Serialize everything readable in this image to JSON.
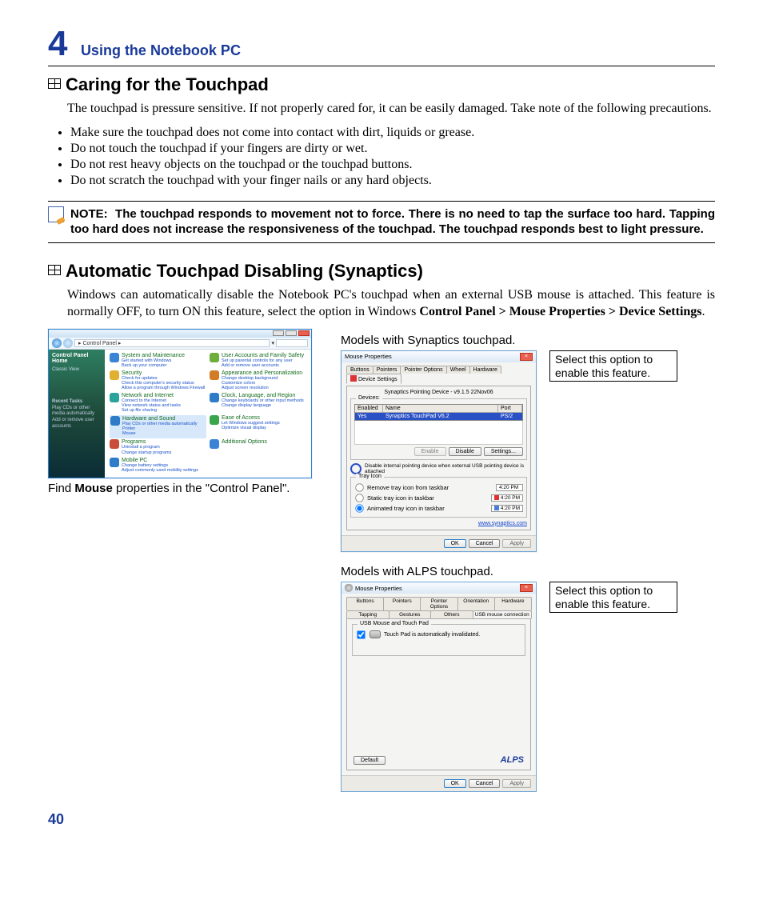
{
  "chapter": {
    "num": "4",
    "title": "Using the Notebook PC"
  },
  "section1": {
    "heading": "Caring for the Touchpad",
    "intro": "The touchpad is pressure sensitive. If not properly cared for, it can be easily damaged. Take note of the following precautions.",
    "bullets": [
      "Make sure the touchpad does not come into contact with dirt, liquids or grease.",
      "Do not touch the touchpad if your fingers are dirty or wet.",
      "Do not rest heavy objects on the touchpad or the touchpad buttons.",
      "Do not scratch the touchpad with your finger nails or any hard objects."
    ],
    "note_label": "NOTE:",
    "note": "The touchpad responds to movement not to force. There is no need to tap the surface too hard. Tapping too hard does not increase the responsiveness of the touchpad. The touchpad responds best to light pressure."
  },
  "section2": {
    "heading": "Automatic Touchpad Disabling (Synaptics)",
    "intro1": "Windows can automatically disable the Notebook PC's touchpad when an external USB mouse is attached. This feature is normally OFF, to turn ON this feature, select the option in Windows ",
    "navpath": "Control Panel > Mouse Properties > Device Settings",
    "cp_caption_prefix": "Find ",
    "cp_caption_bold": "Mouse",
    "cp_caption_suffix": " properties in the \"Control Panel\".",
    "syn_hdr": "Models with Synaptics touchpad.",
    "alps_hdr": "Models with ALPS touchpad.",
    "callout": "Select this option to enable this feature."
  },
  "control_panel": {
    "path": "▸ Control Panel ▸",
    "home": "Control Panel Home",
    "view": "Classic View",
    "tasks_label": "Recent Tasks",
    "tasks": "Play CDs or other media automatically\nAdd or remove user accounts",
    "items": [
      {
        "title": "System and Maintenance",
        "sub": "Get started with Windows\nBack up your computer",
        "color": "#3a84d6"
      },
      {
        "title": "User Accounts and Family Safety",
        "sub": "Set up parental controls for any user\nAdd or remove user accounts",
        "color": "#6eae3b"
      },
      {
        "title": "Security",
        "sub": "Check for updates\nCheck this computer's security status\nAllow a program through Windows Firewall",
        "color": "#e0b030"
      },
      {
        "title": "Appearance and Personalization",
        "sub": "Change desktop background\nCustomize colors\nAdjust screen resolution",
        "color": "#d37c28"
      },
      {
        "title": "Network and Internet",
        "sub": "Connect to the Internet\nView network status and tasks\nSet up file sharing",
        "color": "#2aa39a"
      },
      {
        "title": "Clock, Language, and Region",
        "sub": "Change keyboards or other input methods\nChange display language",
        "color": "#2e7cc7"
      },
      {
        "title": "Hardware and Sound",
        "sub": "Play CDs or other media automatically\nPrinter\nMouse",
        "color": "#2e7cc7",
        "highlight": true
      },
      {
        "title": "Ease of Access",
        "sub": "Let Windows suggest settings\nOptimize visual display",
        "color": "#3aa64b"
      },
      {
        "title": "Programs",
        "sub": "Uninstall a program\nChange startup programs",
        "color": "#c94d38"
      },
      {
        "title": "Additional Options",
        "sub": "",
        "color": "#3a84d6"
      },
      {
        "title": "Mobile PC",
        "sub": "Change battery settings\nAdjust commonly used mobility settings",
        "color": "#2e7cc7"
      }
    ]
  },
  "synaptics": {
    "title": "Mouse Properties",
    "tabs": [
      "Buttons",
      "Pointers",
      "Pointer Options",
      "Wheel",
      "Hardware"
    ],
    "active_tab": "Device Settings",
    "subtitle": "Synaptics Pointing Device - v9.1.5  22Nov06",
    "devices_label": "Devices:",
    "cols": {
      "c1": "Enabled",
      "c2": "Name",
      "c3": "Port"
    },
    "row": {
      "c1": "Yes",
      "c2": "Synaptics TouchPad V6.2",
      "c3": "PS/2"
    },
    "btns": {
      "enable": "Enable",
      "disable": "Disable",
      "settings": "Settings..."
    },
    "disable_check": "Disable internal pointing device when external USB pointing device is attached",
    "tray_label": "Tray Icon",
    "tray_opts": [
      "Remove tray icon from taskbar",
      "Static tray icon in taskbar",
      "Animated tray icon in taskbar"
    ],
    "time": "4:20 PM",
    "link": "www.synaptics.com",
    "ok": "OK",
    "cancel": "Cancel",
    "apply": "Apply"
  },
  "alps": {
    "title": "Mouse Properties",
    "tabs_row1": [
      "Buttons",
      "Pointers",
      "Pointer Options",
      "Orientation",
      "Hardware"
    ],
    "tabs_row2": [
      "Tapping",
      "Gestures",
      "Others",
      "USB mouse connection"
    ],
    "group": "USB Mouse and Touch Pad",
    "msg": "Touch Pad is automatically invalidated.",
    "logo": "ALPS",
    "default": "Default",
    "ok": "OK",
    "cancel": "Cancel",
    "apply": "Apply"
  },
  "page_num": "40"
}
